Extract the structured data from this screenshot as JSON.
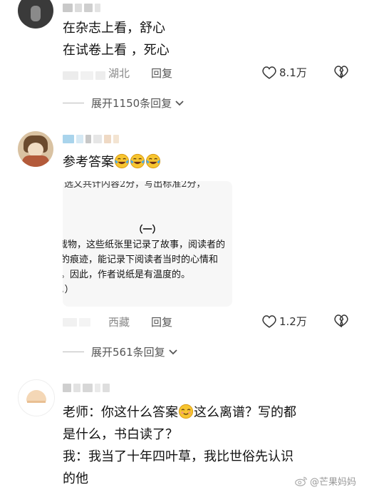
{
  "comments": [
    {
      "lines": [
        "在杂志上看，舒心",
        "在试卷上看 ，死心"
      ],
      "location": "湖北",
      "reply_label": "回复",
      "likes": "8.1万",
      "expand_label": "展开1150条回复"
    },
    {
      "text": "参考答案",
      "emoji": [
        "laughing-tears",
        "laughing-tears",
        "laughing-tears"
      ],
      "image_text": {
        "top_partial": "选文共计内容2分，写出标准2分，",
        "heading": "（一）",
        "line1": "载物，这些纸张里记录了故事，阅读者的",
        "line2": "的痕迹，能记录下阅读者当时的心情和",
        "line3": "。因此，作者说纸是有温度的。",
        "line4": "。）"
      },
      "location": "西藏",
      "reply_label": "回复",
      "likes": "1.2万",
      "expand_label": "展开561条回复"
    },
    {
      "line1_a": "老师：你这什么答案",
      "line1_b": "这么离谱？写的都",
      "line2": "是什么，书白读了？",
      "line3": "我：我当了十年四叶草，我比世俗先认识",
      "line4": "的他"
    }
  ],
  "watermark": "@芒果妈妈",
  "colors": {
    "text": "#111111",
    "meta": "#888888",
    "emoji_yellow": "#f7c530"
  }
}
